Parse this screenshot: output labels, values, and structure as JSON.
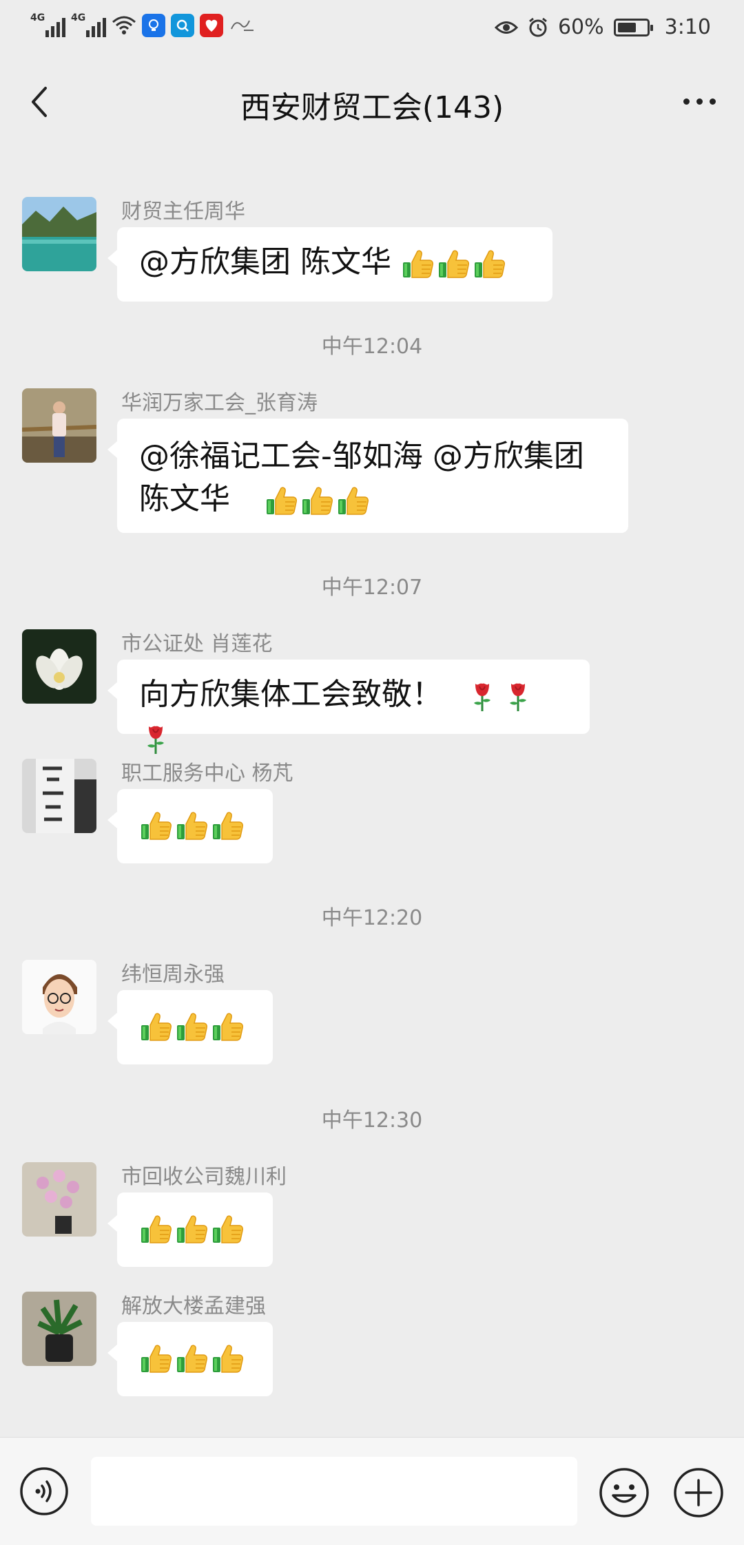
{
  "status_bar": {
    "network_1": "4G",
    "network_2": "4G",
    "battery": "60%",
    "battery_level": 0.6,
    "time": "3:10"
  },
  "header": {
    "title": "西安财贸工会(143)"
  },
  "messages": [
    {
      "sender": "财贸主任周华",
      "text": "@方欣集团  陈文华 ",
      "emoji": [
        "thumbs-up",
        "thumbs-up",
        "thumbs-up"
      ]
    },
    {
      "time": "中午12:04"
    },
    {
      "sender": "华润万家工会_张育涛",
      "line1": "@徐福记工会-邹如海 @方欣集团",
      "line2": "陈文华 ",
      "emoji": [
        "thumbs-up",
        "thumbs-up",
        "thumbs-up"
      ]
    },
    {
      "time": "中午12:07"
    },
    {
      "sender": "市公证处 肖莲花",
      "text": "向方欣集体工会致敬！",
      "emoji": [
        "rose",
        "rose",
        "rose"
      ]
    },
    {
      "sender": "职工服务中心 杨芃",
      "emoji": [
        "thumbs-up",
        "thumbs-up",
        "thumbs-up"
      ]
    },
    {
      "time": "中午12:20"
    },
    {
      "sender": "纬恒周永强",
      "emoji": [
        "thumbs-up",
        "thumbs-up",
        "thumbs-up"
      ]
    },
    {
      "time": "中午12:30"
    },
    {
      "sender": "市回收公司魏川利",
      "emoji": [
        "thumbs-up",
        "thumbs-up",
        "thumbs-up"
      ]
    },
    {
      "sender": "解放大楼孟建强",
      "emoji": [
        "thumbs-up",
        "thumbs-up",
        "thumbs-up"
      ]
    }
  ],
  "input_bar": {
    "voice_icon": "voice-icon",
    "emoji_icon": "smiley-icon",
    "plus_icon": "plus-icon"
  }
}
